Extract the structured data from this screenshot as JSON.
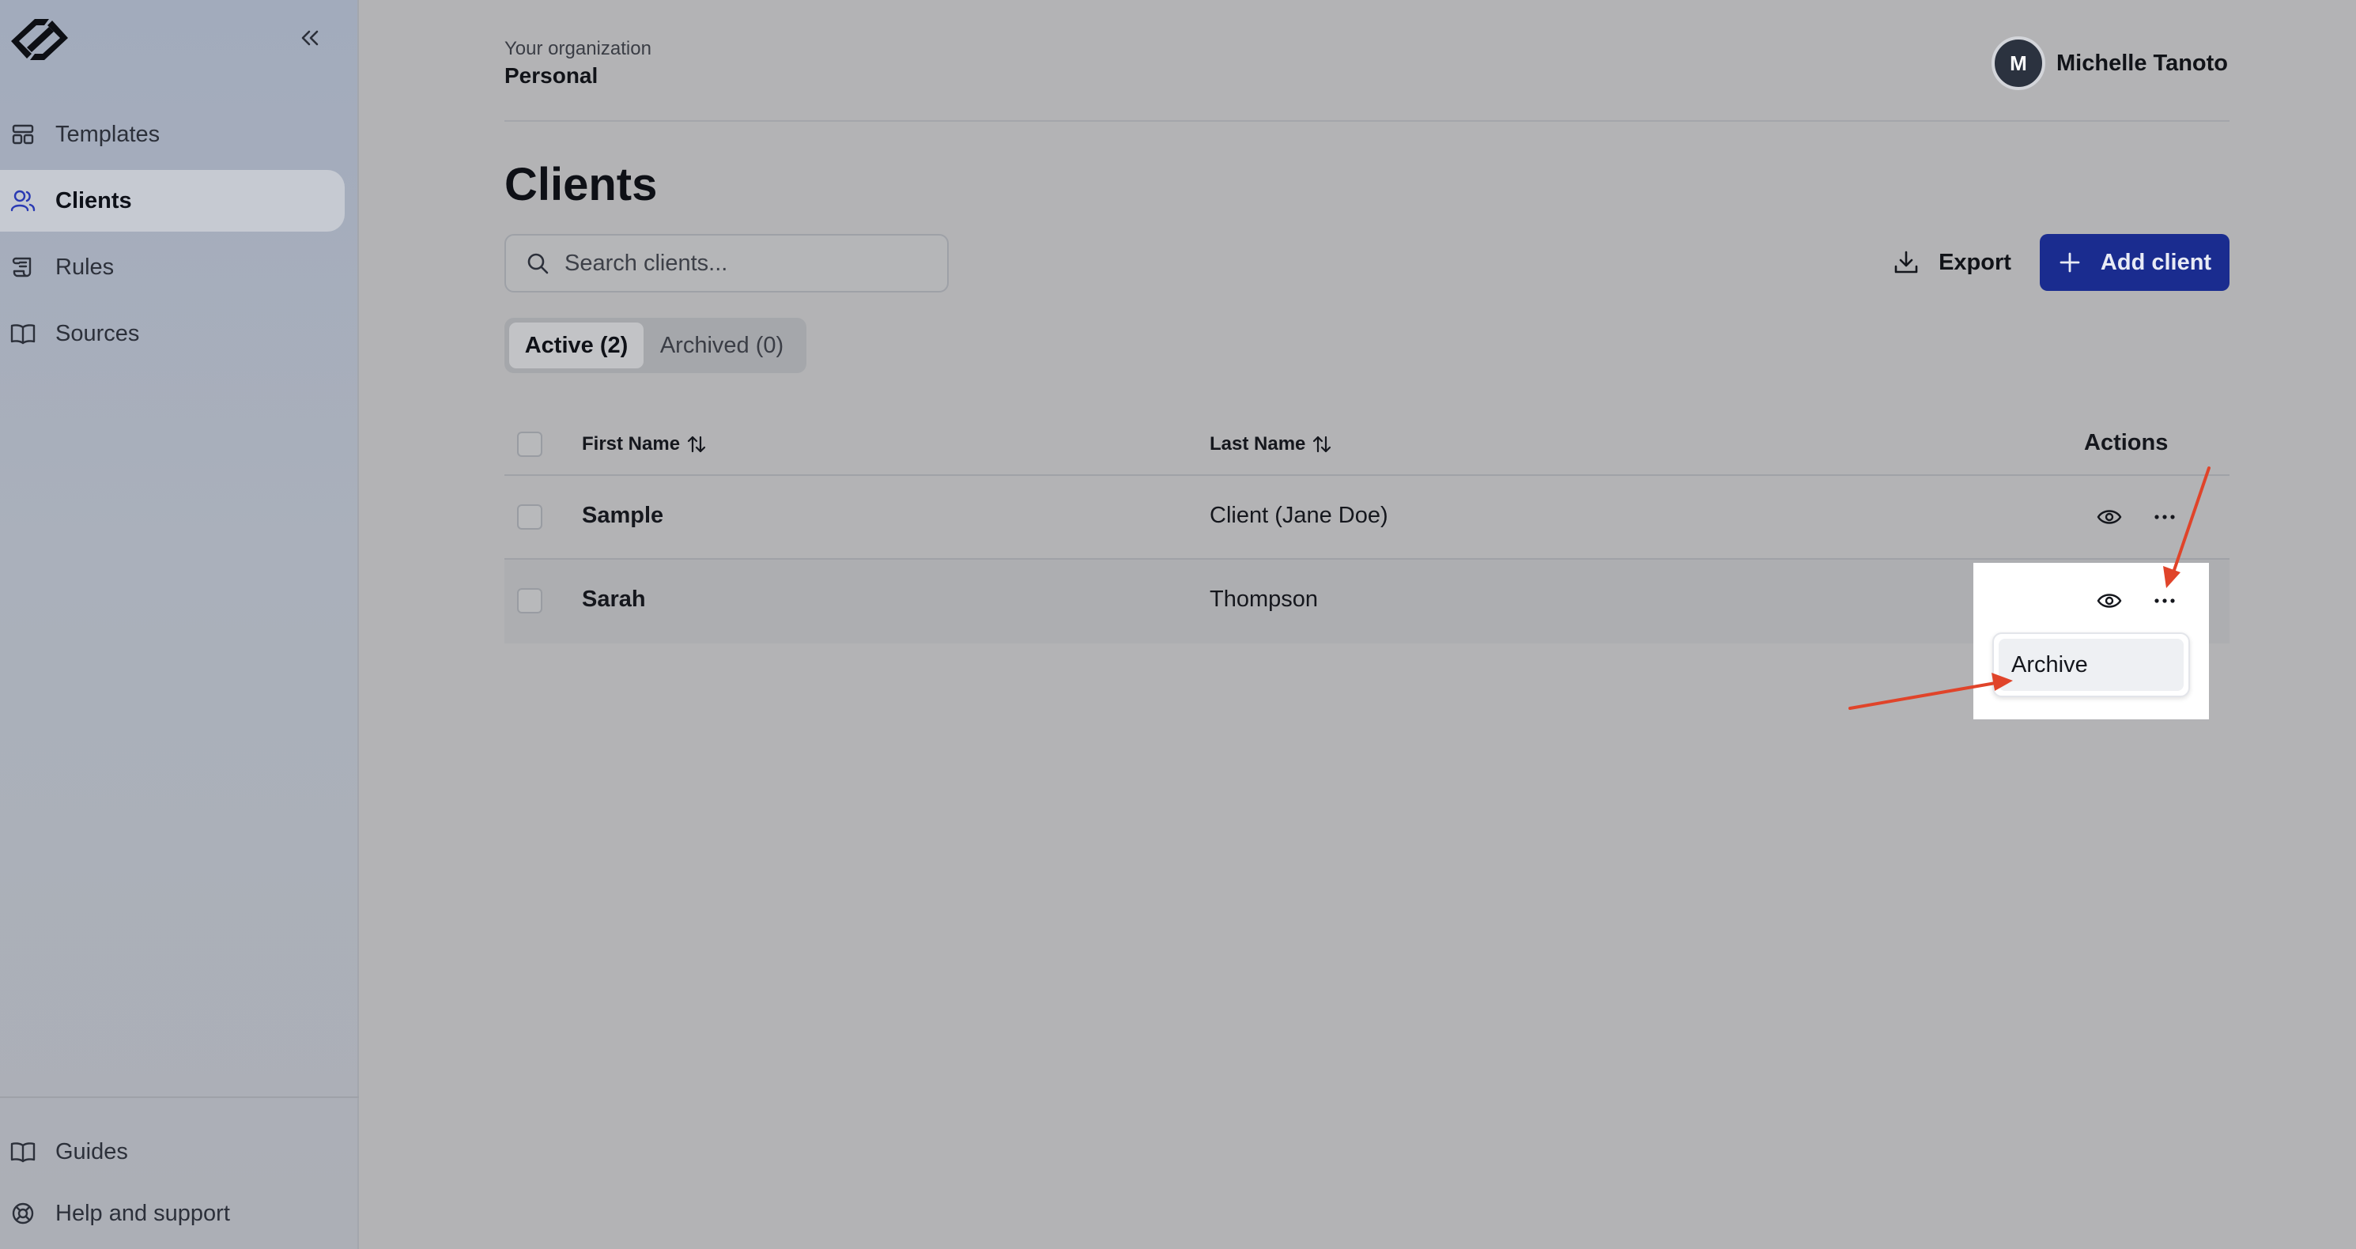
{
  "sidebar": {
    "collapse_icon": "chevrons-left-icon",
    "items": [
      {
        "label": "Templates",
        "icon": "template-icon",
        "active": false
      },
      {
        "label": "Clients",
        "icon": "users-icon",
        "active": true
      },
      {
        "label": "Rules",
        "icon": "scroll-icon",
        "active": false
      },
      {
        "label": "Sources",
        "icon": "book-icon",
        "active": false
      }
    ],
    "footer_items": [
      {
        "label": "Guides",
        "icon": "book-icon"
      },
      {
        "label": "Help and support",
        "icon": "lifebuoy-icon"
      }
    ]
  },
  "header": {
    "org_label": "Your organization",
    "org_name": "Personal",
    "user": {
      "initial": "M",
      "name": "Michelle Tanoto"
    }
  },
  "page": {
    "title": "Clients",
    "search_placeholder": "Search clients...",
    "export_label": "Export",
    "add_label": "Add client",
    "accent_color": "#1a2c8f"
  },
  "tabs": [
    {
      "label": "Active (2)",
      "active": true
    },
    {
      "label": "Archived (0)",
      "active": false
    }
  ],
  "table": {
    "columns": {
      "first": "First Name",
      "last": "Last Name",
      "actions": "Actions"
    },
    "rows": [
      {
        "first": "Sample",
        "last": "Client (Jane Doe)"
      },
      {
        "first": "Sarah",
        "last": "Thompson"
      }
    ]
  },
  "menu": {
    "items": [
      "Archive"
    ]
  },
  "annotations": {
    "arrow_color": "#e0442a"
  }
}
